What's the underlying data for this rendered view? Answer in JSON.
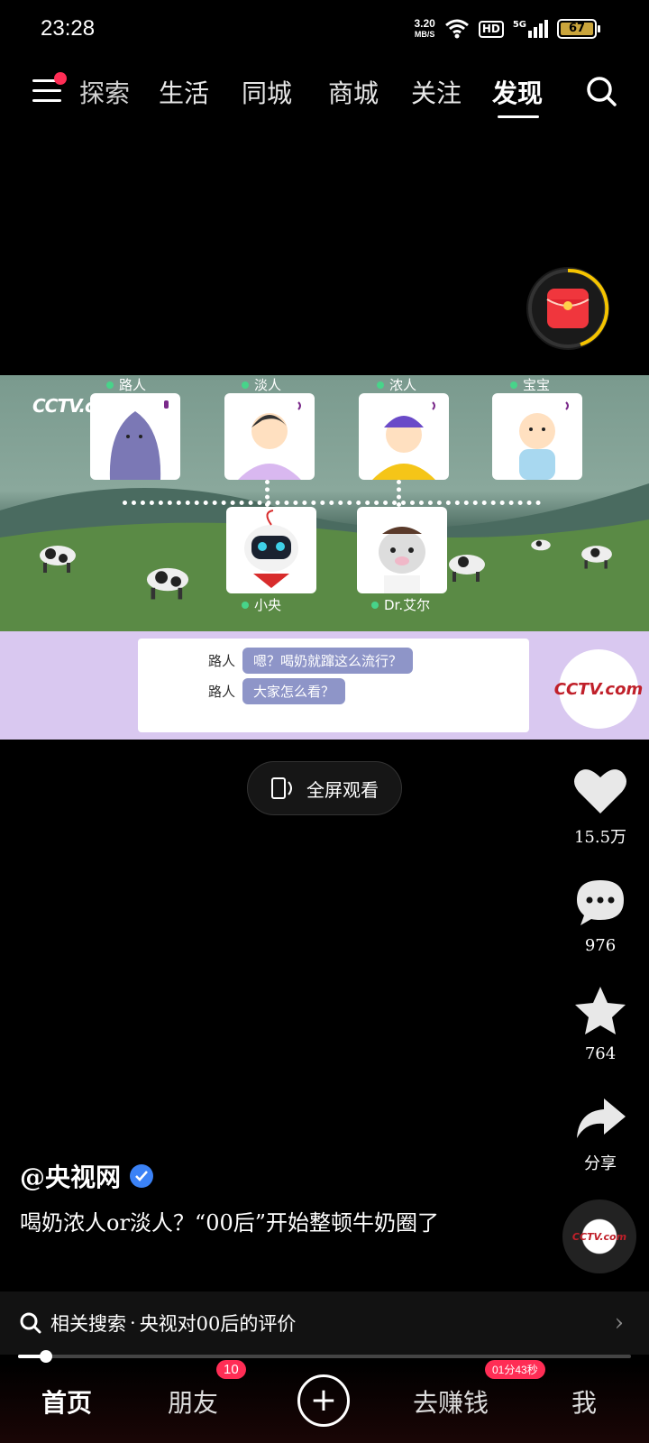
{
  "status_bar": {
    "time": "23:28",
    "net_speed_value": "3.20",
    "net_speed_unit": "MB/S",
    "hd": "HD",
    "network": "5G",
    "battery": "67"
  },
  "top_nav": {
    "tabs": [
      {
        "label": "探索"
      },
      {
        "label": "生活"
      },
      {
        "label": "同城"
      },
      {
        "label": "商城"
      },
      {
        "label": "关注"
      },
      {
        "label": "发现"
      }
    ],
    "active_tab": "发现"
  },
  "video": {
    "watermark": "CCTV.com",
    "top_row": [
      {
        "label": "路人"
      },
      {
        "label": "淡人"
      },
      {
        "label": "浓人"
      },
      {
        "label": "宝宝"
      }
    ],
    "bottom_row": [
      {
        "label": "小央"
      },
      {
        "label": "Dr.艾尔"
      }
    ],
    "chat": [
      {
        "speaker": "路人",
        "text": "嗯？喝奶就蹿这么流行？"
      },
      {
        "speaker": "路人",
        "text": "大家怎么看？"
      }
    ],
    "logo": "CCTV.com"
  },
  "fullscreen_label": "全屏观看",
  "actions": {
    "likes": "15.5万",
    "comments": "976",
    "favorites": "764",
    "share": "分享"
  },
  "author": "@央视网",
  "caption": "喝奶浓人or淡人？“00后”开始整顿牛奶圈了",
  "related_search": {
    "prefix": "相关搜索",
    "separator": "·",
    "query": "央视对00后的评价"
  },
  "playback_progress_percent": 4.5,
  "bottom_nav": {
    "home": "首页",
    "friends": "朋友",
    "friends_badge": "10",
    "earn": "去赚钱",
    "earn_badge": "01分43秒",
    "me": "我"
  },
  "colors": {
    "accent_red": "#ff2d55",
    "verified_blue": "#3b82f6",
    "chat_bubble": "#8e95c8",
    "chat_band": "#d9c8f0"
  }
}
